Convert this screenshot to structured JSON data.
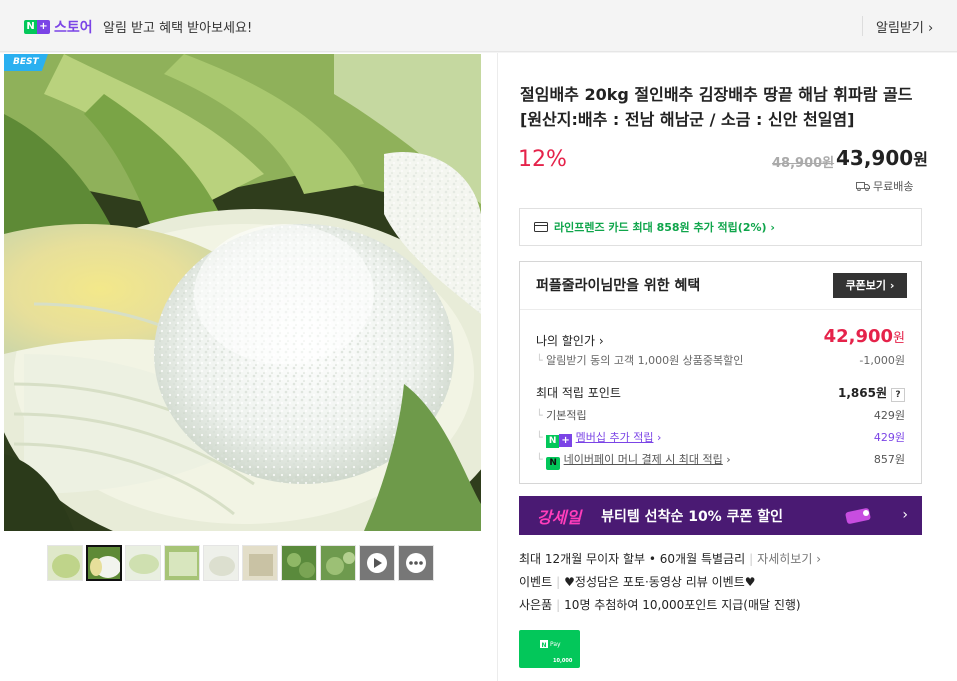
{
  "topbar": {
    "logo_n": "N",
    "logo_plus": "+",
    "store_label": "스토어",
    "notice": "알림 받고 혜택 받아보세요!",
    "alarm_label": "알림받기"
  },
  "gallery": {
    "badge": "BEST",
    "thumb_count": 10
  },
  "product": {
    "title": "절임배추 20kg 절인배추 김장배추 땅끝 해남 휘파람 골드 [원산지:배추 : 전남 해남군 / 소금 : 신안 천일염]",
    "discount": "12%",
    "original_price": "48,900원",
    "price": "43,900",
    "price_unit": "원",
    "shipping": "무료배송"
  },
  "card_promo": "라인프렌즈 카드 최대 858원 추가 적립(2%)",
  "benefit": {
    "title": "퍼플줄라이님만을 위한 혜택",
    "coupon_button": "쿠폰보기",
    "my_discount_label": "나의 할인가",
    "my_discount_price": "42,900",
    "my_discount_unit": "원",
    "discount_note": "알림받기 동의 고객 1,000원 상품중복할인",
    "discount_note_amount": "-1,000원",
    "points_label": "최대 적립 포인트",
    "points_total": "1,865원",
    "help": "?",
    "basic_label": "기본적립",
    "basic_amount": "429원",
    "member_label": "멤버십 추가 적립",
    "member_amount": "429원",
    "npay_label": "네이버페이 머니 결제 시 최대 적립",
    "npay_amount": "857원"
  },
  "banner": {
    "logo": "강세일",
    "text": "뷰티템 선착순 10% 쿠폰 할인"
  },
  "info": {
    "installment": "최대 12개월 무이자 할부 • 60개월 특별금리",
    "installment_link": "자세히보기",
    "event_label": "이벤트",
    "event_text": "♥정성담은 포토·동영상 리뷰 이벤트♥",
    "gift_label": "사은품",
    "gift_text": "10명 추첨하여 10,000포인트 지급(매달 진행)"
  },
  "npay_card": {
    "brand": "Pay",
    "amount": "10,000"
  },
  "colors": {
    "naver_green": "#03c75a",
    "plus_purple": "#7b44e6",
    "discount_red": "#e5234a",
    "banner_purple": "#4a1a73"
  }
}
